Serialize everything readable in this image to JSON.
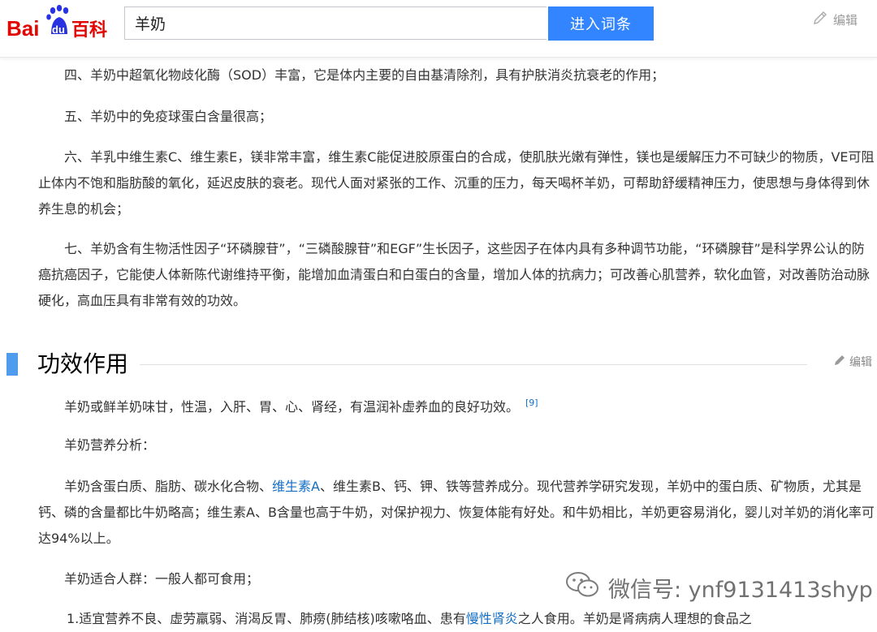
{
  "header": {
    "logo_text_left": "Bai",
    "logo_text_paw": "du",
    "logo_text_right": "百科",
    "search_value": "羊奶",
    "search_button": "进入词条",
    "edit_label": "编辑",
    "colors": {
      "accent": "#3385ff",
      "logo_red": "#e10601",
      "logo_blue": "#2932e1"
    }
  },
  "paragraphs": [
    "四、羊奶中超氧化物歧化酶（SOD）丰富，它是体内主要的自由基清除剂，具有护肤消炎抗衰老的作用；",
    "五、羊奶中的免疫球蛋白含量很高；",
    "六、羊乳中维生素C、维生素E，镁非常丰富，维生素C能促进胶原蛋白的合成，使肌肤光嫩有弹性，镁也是缓解压力不可缺少的物质，VE可阻止体内不饱和脂肪酸的氧化，延迟皮肤的衰老。现代人面对紧张的工作、沉重的压力，每天喝杯羊奶，可帮助舒缓精神压力，使思想与身体得到休养生息的机会；",
    "七、羊奶含有生物活性因子“环磷腺苷”，“三磷酸腺苷”和EGF”生长因子，这些因子在体内具有多种调节功能，“环磷腺苷”是科学界公认的防癌抗癌因子，它能使人体新陈代谢维持平衡，能增加血清蛋白和白蛋白的含量，增加人体的抗病力；可改善心肌营养，软化血管，对改善防治动脉硬化，高血压具有非常有效的功效。"
  ],
  "section": {
    "title": "功效作用",
    "edit_label": "编辑",
    "p1": "羊奶或鲜羊奶味甘，性温，入肝、胃、心、肾经，有温润补虚养血的良好功效。",
    "p1_ref": "[9]",
    "p2": "羊奶营养分析：",
    "p3_a": "羊奶含蛋白质、脂肪、碳水化合物、",
    "p3_link": "维生素A",
    "p3_b": "、维生素B、钙、钾、铁等营养成分。现代营养学研究发现，羊奶中的蛋白质、矿物质，尤其是钙、磷的含量都比牛奶略高；维生素A、B含量也高于牛奶，对保护视力、恢复体能有好处。和牛奶相比，羊奶更容易消化，婴儿对羊奶的消化率可达94%以上。",
    "p4": "羊奶适合人群：一般人都可食用；",
    "p5_a": "1.适宜营养不良、虚劳羸弱、消渴反胃、肺痨(肺结核)咳嗽咯血、患有",
    "p5_link": "慢性肾炎",
    "p5_b": "之人食用。羊奶是肾病病人理想的食品之"
  },
  "watermark": {
    "text": "微信号: ynf9131413shyp",
    "icon": "wechat-icon"
  }
}
